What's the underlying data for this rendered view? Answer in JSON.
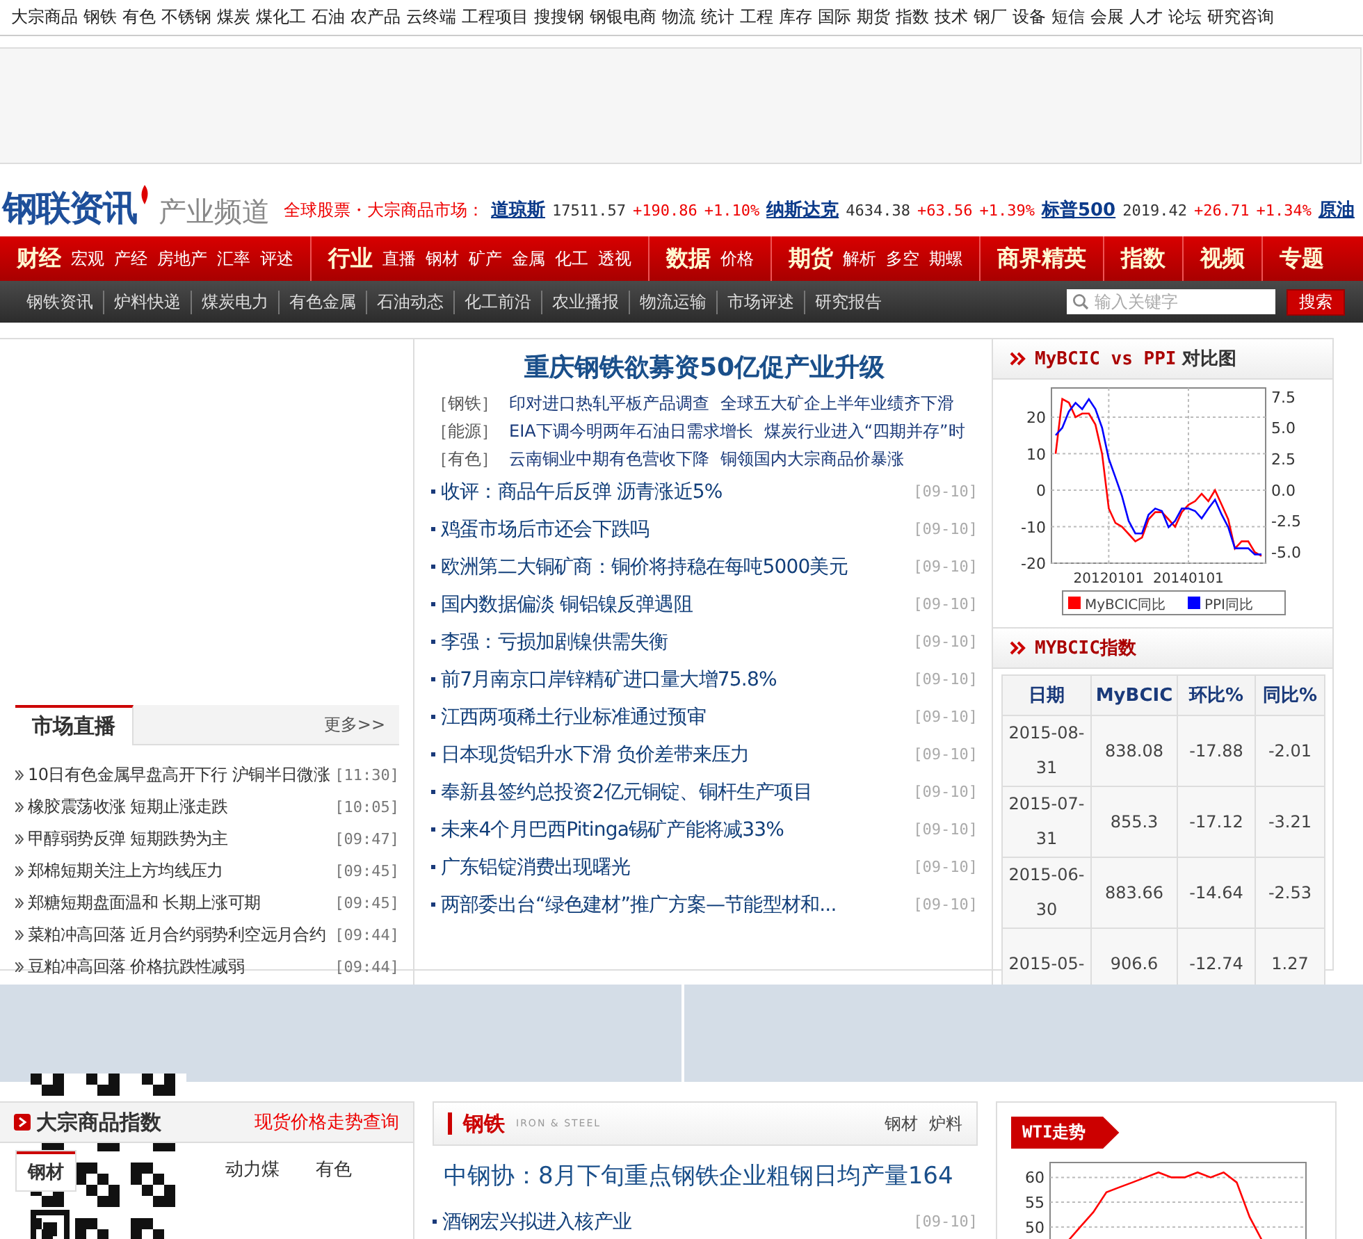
{
  "top_nav": [
    "大宗商品",
    "钢铁",
    "有色",
    "不锈钢",
    "煤炭",
    "煤化工",
    "石油",
    "农产品",
    "云终端",
    "工程项目",
    "搜搜钢",
    "钢银电商",
    "物流",
    "统计",
    "工程",
    "库存",
    "国际",
    "期货",
    "指数",
    "技术",
    "钢厂",
    "设备",
    "短信",
    "会展",
    "人才",
    "论坛",
    "研究咨询"
  ],
  "logo": {
    "brand": "钢联资讯",
    "channel": "产业频道"
  },
  "ticker": {
    "label": "全球股票・大宗商品市场：",
    "items": [
      {
        "name": "道琼斯",
        "price": "17511.57",
        "change": "+190.86",
        "percent": "+1.10%"
      },
      {
        "name": "纳斯达克",
        "price": "4634.38",
        "change": "+63.56",
        "percent": "+1.39%"
      },
      {
        "name": "标普500",
        "price": "2019.42",
        "change": "+26.71",
        "percent": "+1.34%"
      },
      {
        "name": "原油"
      }
    ]
  },
  "main_nav": [
    {
      "title": "财经",
      "links": [
        "宏观",
        "产经",
        "房地产",
        "汇率",
        "评述"
      ]
    },
    {
      "title": "行业",
      "links": [
        "直播",
        "钢材",
        "矿产",
        "金属",
        "化工",
        "透视"
      ]
    },
    {
      "title": "数据",
      "links": [
        "价格"
      ]
    },
    {
      "title": "期货",
      "links": [
        "解析",
        "多空",
        "期螺"
      ]
    },
    {
      "title": "商界精英"
    },
    {
      "title": "指数"
    },
    {
      "title": "视频"
    },
    {
      "title": "专题"
    }
  ],
  "sub_nav": [
    "钢铁资讯",
    "炉料快递",
    "煤炭电力",
    "有色金属",
    "石油动态",
    "化工前沿",
    "农业播报",
    "物流运输",
    "市场评述",
    "研究报告"
  ],
  "search": {
    "placeholder": "输入关键字",
    "button": "搜索"
  },
  "market_live": {
    "title": "市场直播",
    "more": "更多>>",
    "items": [
      {
        "title": "10日有色金属早盘高开下行 沪铜半日微涨",
        "time": "[11:30]"
      },
      {
        "title": "橡胶震荡收涨 短期止涨走跌",
        "time": "[10:05]"
      },
      {
        "title": "甲醇弱势反弹 短期跌势为主",
        "time": "[09:47]"
      },
      {
        "title": "郑棉短期关注上方均线压力",
        "time": "[09:45]"
      },
      {
        "title": "郑糖短期盘面温和 长期上涨可期",
        "time": "[09:45]"
      },
      {
        "title": "菜粕冲高回落 近月合约弱势利空远月合约",
        "time": "[09:44]"
      },
      {
        "title": "豆粕冲高回落 价格抗跌性减弱",
        "time": "[09:44]"
      }
    ]
  },
  "headline": {
    "title": "重庆钢铁欲募资50亿促产业升级",
    "topics": [
      {
        "tag": "［钢铁］",
        "links": [
          "印对进口热轧平板产品调查",
          "全球五大矿企上半年业绩齐下滑"
        ]
      },
      {
        "tag": "［能源］",
        "links": [
          "EIA下调今明两年石油日需求增长",
          "煤炭行业进入“四期并存”时"
        ]
      },
      {
        "tag": "［有色］",
        "links": [
          "云南铜业中期有色营收下降",
          "铜领国内大宗商品价暴涨"
        ]
      }
    ]
  },
  "news": [
    {
      "title": "收评：商品午后反弹 沥青涨近5%",
      "date": "[09-10]"
    },
    {
      "title": "鸡蛋市场后市还会下跌吗",
      "date": "[09-10]"
    },
    {
      "title": "欧洲第二大铜矿商：铜价将持稳在每吨5000美元",
      "date": "[09-10]"
    },
    {
      "title": "国内数据偏淡 铜铝镍反弹遇阻",
      "date": "[09-10]"
    },
    {
      "title": "李强：亏损加剧镍供需失衡",
      "date": "[09-10]"
    },
    {
      "title": "前7月南京口岸锌精矿进口量大增75.8%",
      "date": "[09-10]"
    },
    {
      "title": "江西两项稀土行业标准通过预审",
      "date": "[09-10]"
    },
    {
      "title": "日本现货铝升水下滑 负价差带来压力",
      "date": "[09-10]"
    },
    {
      "title": "奉新县签约总投资2亿元铜锭、铜杆生产项目",
      "date": "[09-10]"
    },
    {
      "title": "未来4个月巴西Pitinga锡矿产能将减33%",
      "date": "[09-10]"
    },
    {
      "title": "广东铝锭消费出现曙光",
      "date": "[09-10]"
    },
    {
      "title": "两部委出台“绿色建材”推广方案—节能型材和...",
      "date": "[09-10]"
    }
  ],
  "compare": {
    "title": "MyBCIC vs PPI",
    "title_suffix": "对比图",
    "chart_data": {
      "type": "line",
      "categories": [
        null,
        null,
        null,
        null,
        null,
        null,
        null,
        null,
        "20120101",
        null,
        null,
        null,
        null,
        null,
        null,
        null,
        null,
        null,
        null,
        null,
        "20140101",
        null,
        null,
        null,
        null,
        null,
        null,
        null,
        null,
        null,
        null,
        null
      ],
      "ylim": [
        -20,
        28
      ],
      "y2lim": [
        -5.9,
        8.2
      ],
      "grid": true,
      "legend": true,
      "yticks": [
        -20,
        -10,
        0,
        10,
        20
      ],
      "y2ticks": [
        {
          "value": -5,
          "label": "-5.0"
        },
        {
          "value": -2.5,
          "label": "-2.5"
        },
        {
          "value": 0,
          "label": "0.0"
        },
        {
          "value": 2.5,
          "label": "2.5"
        },
        {
          "value": 5,
          "label": "5.0"
        },
        {
          "value": 7.5,
          "label": "7.5"
        }
      ],
      "series": [
        {
          "name": "MyBCIC同比",
          "color": "#ff0000",
          "values": [
            10,
            25,
            24,
            20,
            21,
            21,
            18,
            10,
            -5,
            -9,
            -10,
            -12,
            -14,
            -13,
            -8,
            -6,
            -6,
            -8,
            -10,
            -6,
            -4,
            -3,
            -1,
            -3,
            0,
            -4,
            -8,
            -16,
            -14,
            -14,
            -17,
            -18
          ]
        },
        {
          "name": "PPI同比",
          "color": "#0000ff",
          "axis": "y2",
          "values": [
            4.4,
            5,
            6.3,
            7,
            6.5,
            7.3,
            6.5,
            5,
            2.5,
            1,
            -0.5,
            -2.5,
            -3.5,
            -3.5,
            -2,
            -1.5,
            -1.7,
            -3,
            -2.5,
            -1.5,
            -1.5,
            -1.7,
            -2.3,
            -1.5,
            -0.8,
            -2,
            -3,
            -4.7,
            -4.7,
            -4.7,
            -5.2,
            -5.2
          ]
        }
      ]
    }
  },
  "index_table": {
    "title": "MYBCIC指数",
    "columns": [
      "日期",
      "MyBCIC",
      "环比%",
      "同比%"
    ],
    "rows": [
      [
        "2015-08-31",
        "838.08",
        "-17.88",
        "-2.01"
      ],
      [
        "2015-07-31",
        "855.3",
        "-17.12",
        "-3.21"
      ],
      [
        "2015-06-30",
        "883.66",
        "-14.64",
        "-2.53"
      ],
      [
        "2015-05-",
        "906.6",
        "-12.74",
        "1.27"
      ]
    ]
  },
  "commodity_index": {
    "title": "大宗商品指数",
    "link": "现货价格走势查询",
    "tabs": [
      {
        "label": "钢材",
        "selected": true
      },
      {
        "label": "动力煤",
        "selected": false
      },
      {
        "label": "有色",
        "selected": false
      }
    ]
  },
  "steel": {
    "title": "钢铁",
    "subtitle": "IRON & STEEL",
    "links": [
      "钢材",
      "炉料"
    ],
    "headline": "中钢协：8月下旬重点钢铁企业粗钢日均产量164",
    "news": [
      {
        "title": "酒钢宏兴拟进入核产业",
        "date": "[09-10]"
      }
    ]
  },
  "wti": {
    "title": "WTI走势",
    "chart_data": {
      "type": "line",
      "categories": [
        null,
        null,
        null,
        null,
        null,
        null,
        null,
        null,
        null,
        null,
        null,
        null,
        null,
        null,
        null,
        null,
        null,
        null,
        null,
        null
      ],
      "ylim": [
        40,
        63
      ],
      "yticks": [
        50,
        55,
        60
      ],
      "grid": true,
      "series": [
        {
          "color": "#ff0000",
          "values": [
            null,
            47,
            50,
            53,
            57,
            58,
            59,
            60,
            61,
            60,
            60,
            61,
            60,
            61,
            59,
            52,
            47,
            null,
            null,
            null
          ]
        }
      ]
    }
  }
}
